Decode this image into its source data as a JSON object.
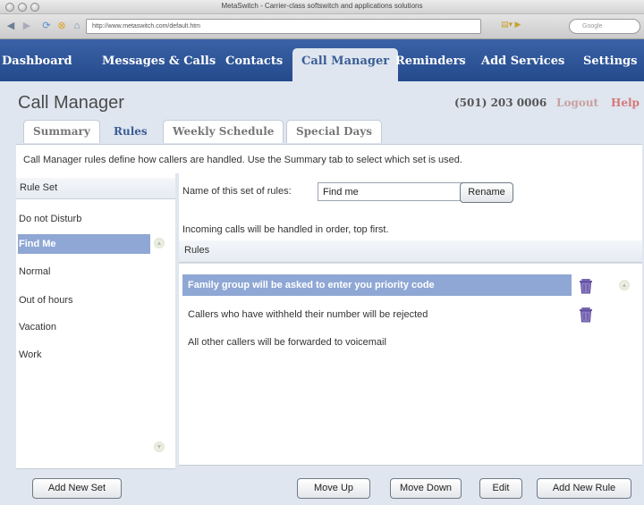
{
  "browser": {
    "window_title": "MetaSwitch - Carrier-class softswitch and applications solutions",
    "url": "http://www.metaswitch.com/default.htm",
    "search_placeholder": "Google"
  },
  "nav": {
    "items": [
      {
        "label": "Dashboard"
      },
      {
        "label": "Messages & Calls"
      },
      {
        "label": "Contacts"
      },
      {
        "label": "Call Manager",
        "active": true
      },
      {
        "label": "Reminders"
      },
      {
        "label": "Add Services"
      },
      {
        "label": "Settings"
      }
    ]
  },
  "header": {
    "title": "Call Manager",
    "phone": "(501) 203 0006",
    "logout": "Logout",
    "help": "Help"
  },
  "tabs": [
    {
      "label": "Summary"
    },
    {
      "label": "Rules",
      "active": true
    },
    {
      "label": "Weekly Schedule"
    },
    {
      "label": "Special Days"
    }
  ],
  "description": "Call Manager rules define how callers are handled.  Use the Summary tab to select which set is used.",
  "rule_sets": {
    "header": "Rule Set",
    "items": [
      {
        "label": "Do not Disturb"
      },
      {
        "label": "Find Me",
        "selected": true
      },
      {
        "label": "Normal"
      },
      {
        "label": "Out of hours"
      },
      {
        "label": "Vacation"
      },
      {
        "label": "Work"
      }
    ],
    "add_button": "Add New Set"
  },
  "rule_editor": {
    "name_label": "Name of this set of rules:",
    "name_value": "Find me",
    "rename_button": "Rename",
    "incoming_note": "Incoming calls will be handled in order, top first.",
    "rules_header": "Rules",
    "rules": [
      {
        "text": "Family group will be asked to enter you priority code",
        "selected": true,
        "deletable": true
      },
      {
        "text": "Callers who have withheld their number will be rejected",
        "deletable": true
      },
      {
        "text": "All other callers will be forwarded to voicemail",
        "deletable": false
      }
    ],
    "buttons": {
      "move_up": "Move Up",
      "move_down": "Move Down",
      "edit": "Edit",
      "add_rule": "Add New Rule"
    }
  },
  "colors": {
    "nav_bg": "#2d5596",
    "selection": "#8fa7d4",
    "content_bg": "#dfe6f0",
    "help": "#d57878"
  }
}
